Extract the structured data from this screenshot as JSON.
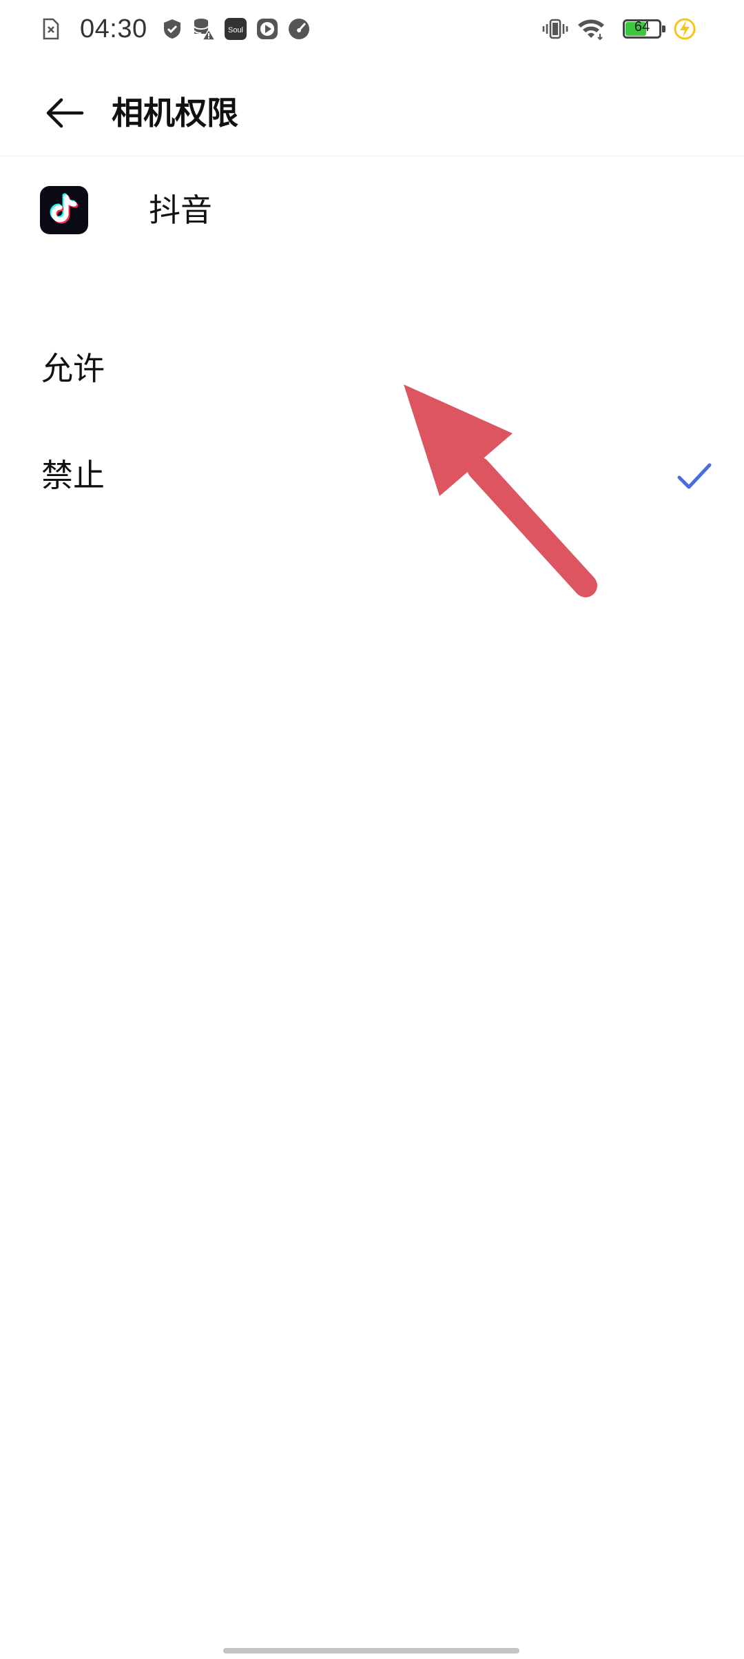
{
  "status_bar": {
    "time": "04:30",
    "battery_level": "64",
    "battery_fill_fraction": 0.64,
    "icons": [
      "file-x-icon",
      "shield-icon",
      "database-warning-icon",
      "soul-app-icon",
      "play-icon",
      "speedometer-icon",
      "vibrate-icon",
      "wifi-icon",
      "battery-icon",
      "charging-icon"
    ],
    "soul_label": "Soul"
  },
  "header": {
    "title": "相机权限",
    "back_icon": "back-arrow-icon"
  },
  "app": {
    "name": "抖音",
    "icon": "tiktok-icon"
  },
  "options": [
    {
      "label": "允许",
      "selected": false
    },
    {
      "label": "禁止",
      "selected": true
    }
  ],
  "colors": {
    "accent": "#4a6cdf",
    "annotation_arrow": "#dc5560",
    "battery": "#3ec63e",
    "charging": "#f5c518"
  }
}
